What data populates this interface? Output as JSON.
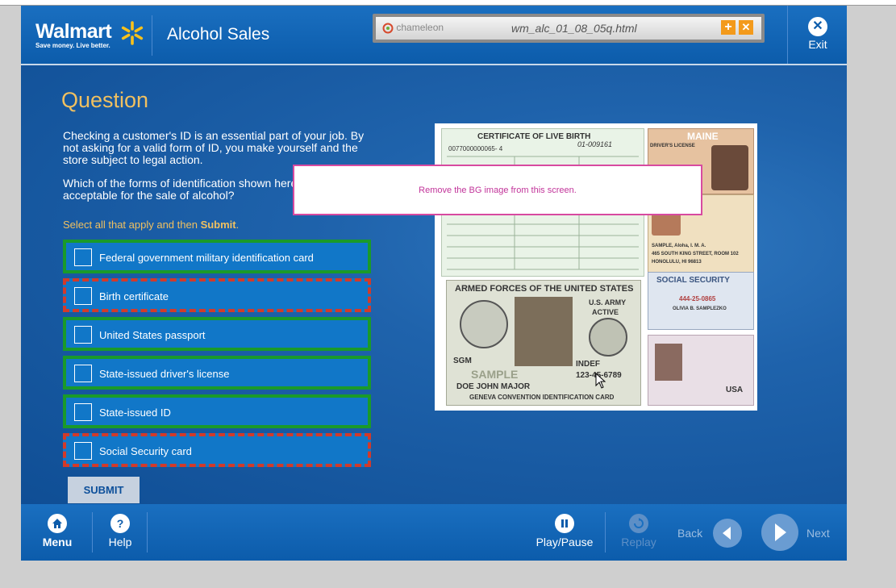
{
  "header": {
    "brand": "Walmart",
    "brand_tagline": "Save money. Live better.",
    "app_title": "Alcohol Sales",
    "chameleon_label": "chameleon",
    "chameleon_file": "wm_alc_01_08_05q.html",
    "chameleon_add": "+",
    "chameleon_close": "✕",
    "exit_label": "Exit",
    "exit_icon": "✕"
  },
  "question": {
    "title": "Question",
    "paragraph1": "Checking a customer's ID is an essential part of your job.  By not asking for a valid form of ID, you make yourself and the store subject to legal action.",
    "paragraph2": "Which of the forms of identification shown here are acceptable for the sale of alcohol?",
    "hint_prefix": "Select all that apply and then ",
    "hint_action": "Submit",
    "hint_suffix": "."
  },
  "options": [
    {
      "label": "Federal government military identification card",
      "status": "correct"
    },
    {
      "label": "Birth certificate",
      "status": "incorrect"
    },
    {
      "label": "United States passport",
      "status": "correct"
    },
    {
      "label": "State-issued driver's license",
      "status": "correct"
    },
    {
      "label": "State-issued ID",
      "status": "correct"
    },
    {
      "label": "Social Security card",
      "status": "incorrect"
    }
  ],
  "submit_label": "SUBMIT",
  "popup_note": "Remove the BG image from this screen.",
  "id_images": {
    "birth_certificate_title": "CERTIFICATE OF LIVE BIRTH",
    "birth_certificate_number": "01-009161",
    "birth_certificate_file_no": "0077000000065- 4",
    "drivers_license_state": "MAINE",
    "drivers_license_header": "DRIVER'S LICENSE",
    "hawaii_id_name": "SAMPLE, Aloha, I. M. A.",
    "hawaii_id_address": "465 SOUTH KING STREET, ROOM 102",
    "hawaii_id_city": "HONOLULU, HI 96813",
    "military_title": "ARMED FORCES OF THE UNITED STATES",
    "military_branch": "U.S. ARMY",
    "military_status": "ACTIVE",
    "military_rank": "SGM",
    "military_expiration": "INDEF",
    "military_ssn": "123-45-6789",
    "military_name": "DOE JOHN MAJOR",
    "military_footer": "GENEVA CONVENTION IDENTIFICATION CARD",
    "sample_stamp": "SAMPLE",
    "ssn_title": "SOCIAL SECURITY",
    "ssn_number": "444-25-0865",
    "ssn_name": "OLIVIA B. SAMPLEZKO",
    "passport_country": "USA"
  },
  "footer": {
    "menu_label": "Menu",
    "help_label": "Help",
    "help_icon": "?",
    "play_label": "Play/Pause",
    "replay_label": "Replay",
    "back_label": "Back",
    "next_label": "Next"
  },
  "colors": {
    "brand_blue": "#0c5cab",
    "accent_yellow": "#f0c060",
    "correct_border": "#1a9a2a",
    "incorrect_border": "#d23a2a",
    "popup_pink": "#c2349a"
  }
}
